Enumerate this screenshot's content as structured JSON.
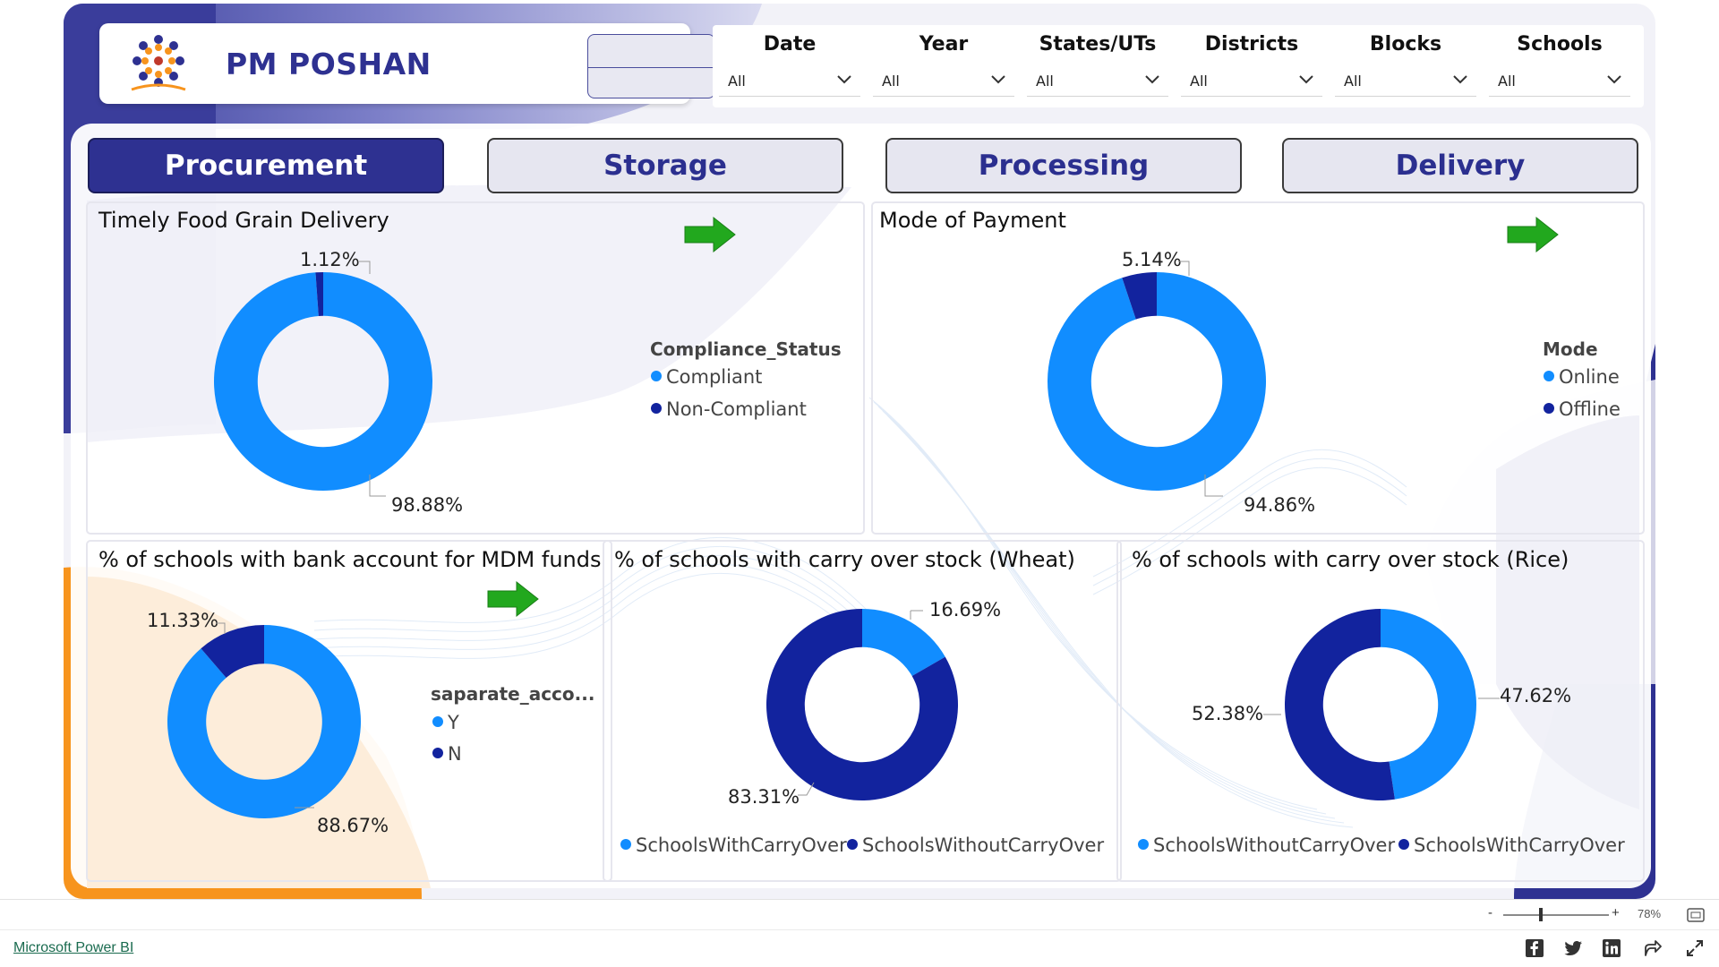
{
  "header": {
    "app_title": "PM POSHAN"
  },
  "filters": [
    {
      "label": "Date",
      "value": "All"
    },
    {
      "label": "Year",
      "value": "All"
    },
    {
      "label": "States/UTs",
      "value": "All"
    },
    {
      "label": "Districts",
      "value": "All"
    },
    {
      "label": "Blocks",
      "value": "All"
    },
    {
      "label": "Schools",
      "value": "All"
    }
  ],
  "tabs": [
    {
      "label": "Procurement",
      "active": true
    },
    {
      "label": "Storage",
      "active": false
    },
    {
      "label": "Processing",
      "active": false
    },
    {
      "label": "Delivery",
      "active": false
    }
  ],
  "colors": {
    "light_blue": "#118dff",
    "dark_blue": "#12239e",
    "brand_purple": "#2e3191",
    "arrow_green": "#22a81e",
    "accent_orange": "#f7941d"
  },
  "icons": {
    "arrow": "green-right-arrow-icon",
    "chevron": "chevron-down-icon",
    "logo": "pm-poshan-logo"
  },
  "chart_data": [
    {
      "type": "pie",
      "title": "Timely Food Grain Delivery",
      "legend_title": "Compliance_Status",
      "series": [
        {
          "name": "Compliant",
          "value": 98.88,
          "label": "98.88%",
          "color": "#118dff"
        },
        {
          "name": "Non-Compliant",
          "value": 1.12,
          "label": "1.12%",
          "color": "#12239e"
        }
      ]
    },
    {
      "type": "pie",
      "title": "Mode of Payment",
      "legend_title": "Mode",
      "series": [
        {
          "name": "Online",
          "value": 94.86,
          "label": "94.86%",
          "color": "#118dff"
        },
        {
          "name": "Offline",
          "value": 5.14,
          "label": "5.14%",
          "color": "#12239e"
        }
      ]
    },
    {
      "type": "pie",
      "title": "% of schools with bank account for MDM funds",
      "legend_title": "saparate_acco...",
      "series": [
        {
          "name": "Y",
          "value": 88.67,
          "label": "88.67%",
          "color": "#118dff"
        },
        {
          "name": "N",
          "value": 11.33,
          "label": "11.33%",
          "color": "#12239e"
        }
      ]
    },
    {
      "type": "pie",
      "title": "% of schools with carry over stock (Wheat)",
      "series": [
        {
          "name": "SchoolsWithCarryOver",
          "value": 16.69,
          "label": "16.69%",
          "color": "#118dff"
        },
        {
          "name": "SchoolsWithoutCarryOver",
          "value": 83.31,
          "label": "83.31%",
          "color": "#12239e"
        }
      ]
    },
    {
      "type": "pie",
      "title": "% of schools with carry over stock (Rice)",
      "series": [
        {
          "name": "SchoolsWithoutCarryOver",
          "value": 47.62,
          "label": "47.62%",
          "color": "#118dff"
        },
        {
          "name": "SchoolsWithCarryOver",
          "value": 52.38,
          "label": "52.38%",
          "color": "#12239e"
        }
      ]
    }
  ],
  "zoom": {
    "minus": "-",
    "plus": "+",
    "percent": "78%",
    "level": 0.78
  },
  "footer": {
    "link_text": "Microsoft Power BI",
    "share_icons": [
      "facebook-icon",
      "twitter-icon",
      "linkedin-icon",
      "share-icon",
      "expand-icon"
    ]
  }
}
